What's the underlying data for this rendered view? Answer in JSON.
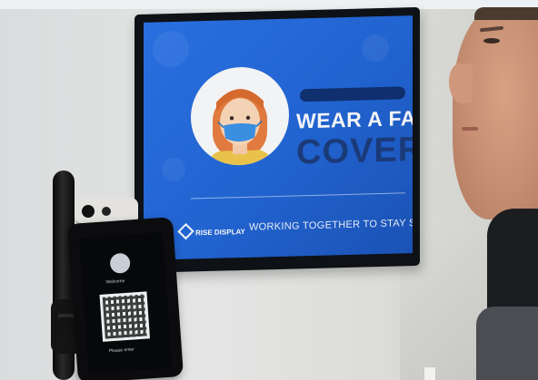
{
  "screen": {
    "headline_top": "WEAR A FACE",
    "headline_bottom": "COVER",
    "brand": "RISE DISPLAY",
    "tagline": "WORKING TOGETHER TO STAY SAFE!"
  },
  "kiosk": {
    "welcome": "Welcome",
    "scan_hint": "Please enter"
  },
  "colors": {
    "screen_blue": "#2163cf",
    "headline_navy": "#1b3a78",
    "mask_blue": "#3a8fe0"
  }
}
